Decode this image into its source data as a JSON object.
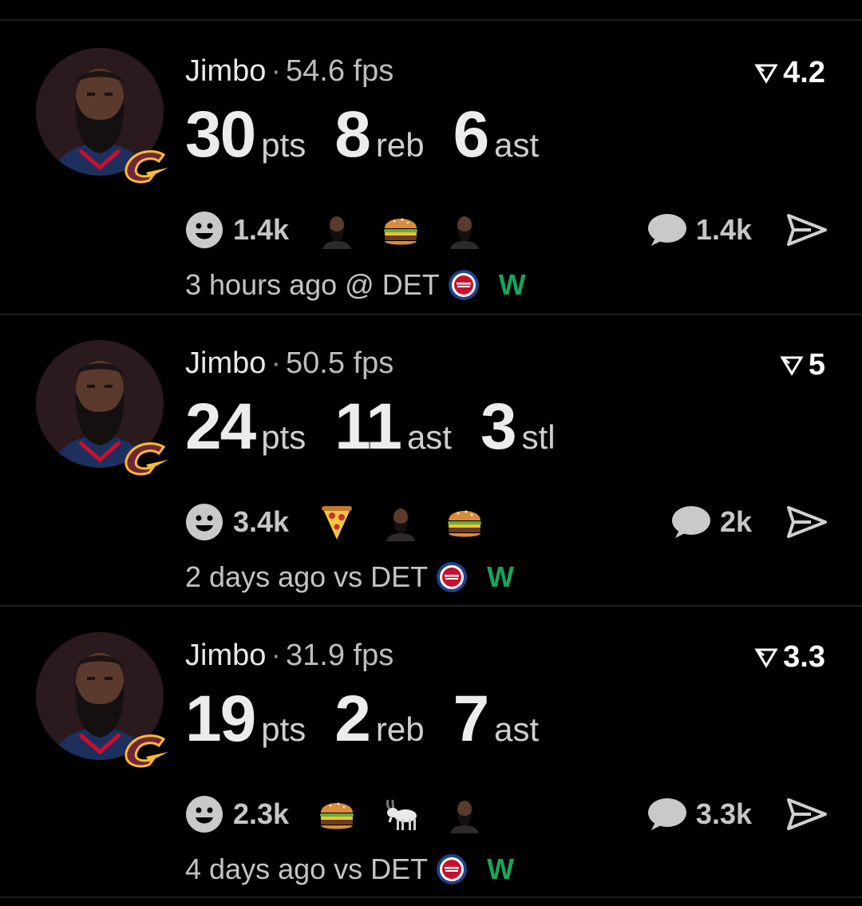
{
  "posts": [
    {
      "user": "Jimbo",
      "separator": "·",
      "fps": "54.6 fps",
      "score": "4.2",
      "stats": [
        {
          "value": "30",
          "label": "pts"
        },
        {
          "value": "8",
          "label": "reb"
        },
        {
          "value": "6",
          "label": "ast"
        }
      ],
      "reaction_count": "1.4k",
      "emojis": [
        "player-photo-icon",
        "burger-icon",
        "player-photo-icon"
      ],
      "comment_count": "1.4k",
      "time": "3 hours ago @ DET",
      "result": "W"
    },
    {
      "user": "Jimbo",
      "separator": "·",
      "fps": "50.5 fps",
      "score": "5",
      "stats": [
        {
          "value": "24",
          "label": "pts"
        },
        {
          "value": "11",
          "label": "ast"
        },
        {
          "value": "3",
          "label": "stl"
        }
      ],
      "reaction_count": "3.4k",
      "emojis": [
        "pizza-icon",
        "player-photo-icon",
        "burger-icon"
      ],
      "comment_count": "2k",
      "time": "2 days ago vs DET",
      "result": "W"
    },
    {
      "user": "Jimbo",
      "separator": "·",
      "fps": "31.9 fps",
      "score": "3.3",
      "stats": [
        {
          "value": "19",
          "label": "pts"
        },
        {
          "value": "2",
          "label": "reb"
        },
        {
          "value": "7",
          "label": "ast"
        }
      ],
      "reaction_count": "2.3k",
      "emojis": [
        "burger-icon",
        "goat-icon",
        "player-photo-icon"
      ],
      "comment_count": "3.3k",
      "time": "4 days ago vs DET",
      "result": "W"
    }
  ],
  "colors": {
    "background": "#000000",
    "divider": "#1e1e1e",
    "win": "#17a55a",
    "team_accent": "#c8102e"
  }
}
